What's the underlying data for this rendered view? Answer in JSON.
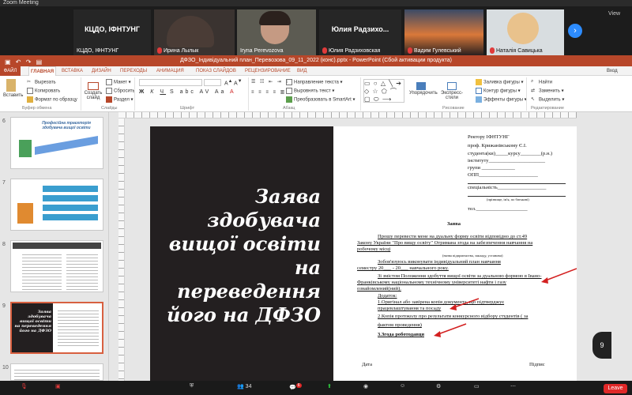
{
  "zoom": {
    "window_title": "Zoom Meeting",
    "view_label": "View",
    "next_label": "›",
    "participants": [
      {
        "name": "КЦДО, ІФНТУНГ",
        "display": "КЦДО, ІФНТУНГ"
      },
      {
        "name": "Ирина Лылык",
        "display": ""
      },
      {
        "name": "Iryna Perevozova",
        "display": ""
      },
      {
        "name": "Юлия Радзиховская",
        "display": "Юлия  Радзихо..."
      },
      {
        "name": "Вадим Гулевський",
        "display": ""
      },
      {
        "name": "Наталія Савицька",
        "display": ""
      }
    ],
    "participants_count": "34",
    "toolbar": {
      "chat_badge": "6",
      "leave": "Leave"
    }
  },
  "ppt": {
    "title": "ДФЗО_Індивідуальний план_Перевозова_09_11_2022 (конс).pptx - PowerPoint (Сбой активации продукта)",
    "tabs": [
      "ФАЙЛ",
      "ГЛАВНАЯ",
      "ВСТАВКА",
      "ДИЗАЙН",
      "ПЕРЕХОДЫ",
      "АНИМАЦИЯ",
      "ПОКАЗ СЛАЙДОВ",
      "РЕЦЕНЗИРОВАНИЕ",
      "ВИД"
    ],
    "active_tab": "ГЛАВНАЯ",
    "signin": "Вход",
    "ribbon": {
      "paste": "Вставить",
      "cut": "Вырезать",
      "copy": "Копировать",
      "format_painter": "Формат по образцу",
      "clipboard": "Буфер обмена",
      "create_slide": "Создать слайд",
      "layout": "Макет",
      "reset": "Сбросить",
      "section": "Раздел",
      "slides_group": "Слайды",
      "font_group": "Шрифт",
      "text_direction": "Направление текста",
      "align_text": "Выровнять текст",
      "smartart": "Преобразовать в SmartArt",
      "paragraph_group": "Абзац",
      "arrange": "Упорядочить",
      "quick_styles": "Экспресс-стили",
      "shape_fill": "Заливка фигуры",
      "shape_outline": "Контур фигуры",
      "shape_effects": "Эффекты фигуры",
      "drawing_group": "Рисование",
      "find": "Найти",
      "replace": "Заменить",
      "select": "Выделить",
      "editing_group": "Редактирование"
    },
    "thumbnails": [
      {
        "num": "6",
        "text": "Професійна траєкторія здобувача вищої освіти"
      },
      {
        "num": "7",
        "text": ""
      },
      {
        "num": "8",
        "text": ""
      },
      {
        "num": "9",
        "text": "Заява здобувача вищої освіти на переведення його на ДФЗО"
      },
      {
        "num": "10",
        "text": ""
      }
    ],
    "slide": {
      "title": "Заява здобувача вищої освіти на переведення його на ДФЗО",
      "page_number": "9",
      "doc": {
        "addressee1": "Ректору ІФНТУНГ",
        "addressee2": "проф. Крижанівському Є.І.",
        "line_student": "студента(ки)_____курсу________(р.н.)",
        "line_institute": "інституту______________________",
        "line_group": "групи _____________",
        "line_opp": "ОПП_______________________",
        "line_specialty": "спеціальність___________________",
        "pib_hint": "(прізвище, ім'я, по батькові)",
        "phone": "тел.____________________",
        "heading": "Заява",
        "p1": "Прошу перевести  мене на дуальну форму освіти  відповідно до ст.49",
        "p2": "Закону України \"Про вищу освіту\" Отримана згода на забезпечення навчання на",
        "p3": "робочому місці",
        "p3_hint": "(назва підприємства, закладу, установи)",
        "p4": "Зобов'язуюсь  виконувати  індивідуальний  план  навчання",
        "p5": "семестру  20___ - 20___ навчального року.",
        "p6": "Зі змістом Положення здобуття вищої освіти за дуальною формою в Івано-",
        "p7": "Франківському  національному  технічному  університеті  нафти  і  газу",
        "p8": "ознайомлений(ний).",
        "att": "Додаток:",
        "att1a": "1.Оригінал  або  завірена  копія  документа,  що  підтверджує",
        "att1b": "працевлаштування та посаду",
        "att2a": "2.Копія протоколу про результати конкурсного відбору  студентів ( за",
        "att2b": "фактом проведення)",
        "att3": "3.Згода роботодавця",
        "date": "Дата",
        "signature": "Підпис"
      }
    }
  },
  "colors": {
    "ppt_red": "#b7472a",
    "zoom_blue": "#2d8cff",
    "leave_red": "#e02828",
    "arrow_red": "#d32020"
  }
}
